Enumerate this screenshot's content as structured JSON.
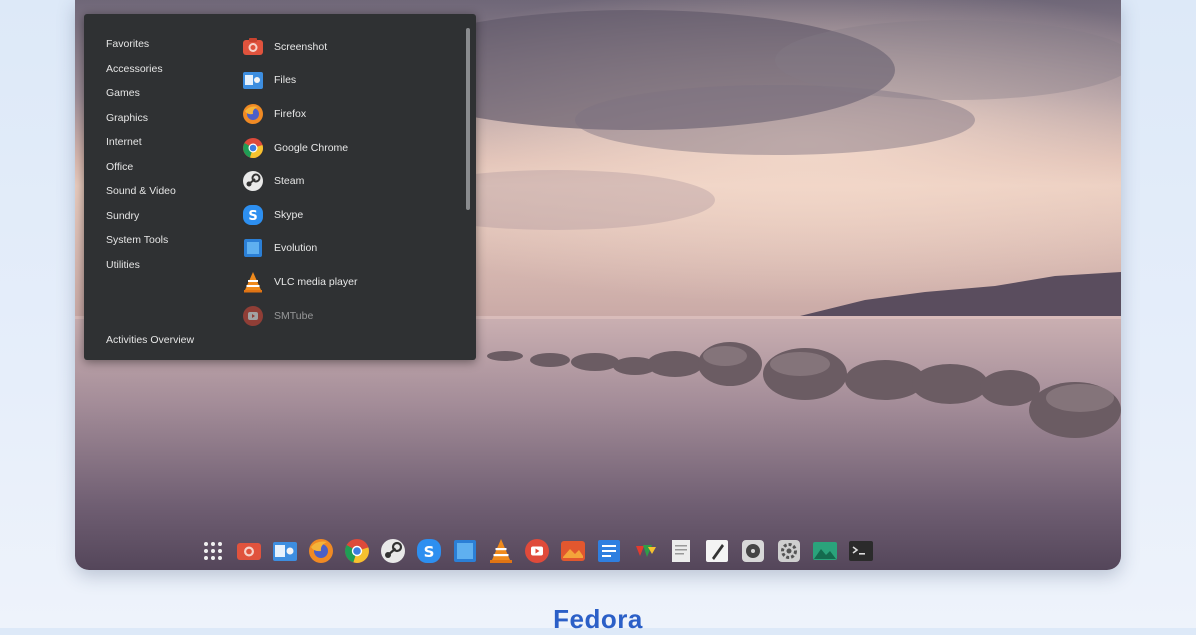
{
  "menu": {
    "categories": [
      "Favorites",
      "Accessories",
      "Games",
      "Graphics",
      "Internet",
      "Office",
      "Sound & Video",
      "Sundry",
      "System Tools",
      "Utilities"
    ],
    "overview": "Activities Overview",
    "apps": [
      {
        "label": "Screenshot",
        "icon": "screenshot-icon"
      },
      {
        "label": "Files",
        "icon": "files-icon"
      },
      {
        "label": "Firefox",
        "icon": "firefox-icon"
      },
      {
        "label": "Google Chrome",
        "icon": "chrome-icon"
      },
      {
        "label": "Steam",
        "icon": "steam-icon"
      },
      {
        "label": "Skype",
        "icon": "skype-icon"
      },
      {
        "label": "Evolution",
        "icon": "evolution-icon"
      },
      {
        "label": "VLC media player",
        "icon": "vlc-icon"
      },
      {
        "label": "SMTube",
        "icon": "smtube-icon"
      }
    ]
  },
  "dock": [
    "apps-grid-icon",
    "screenshot-icon",
    "files-icon",
    "firefox-icon",
    "chrome-icon",
    "steam-icon",
    "skype-icon",
    "evolution-icon",
    "vlc-icon",
    "smtube-icon",
    "photo-app-icon",
    "notes-app-icon",
    "color-app-icon",
    "document-app-icon",
    "text-editor-icon",
    "disk-utility-icon",
    "settings-icon",
    "image-viewer-icon",
    "terminal-icon"
  ],
  "caption": "Fedora",
  "colors": {
    "caption": "#2b5fc7",
    "menu_bg": "#2f3133"
  }
}
